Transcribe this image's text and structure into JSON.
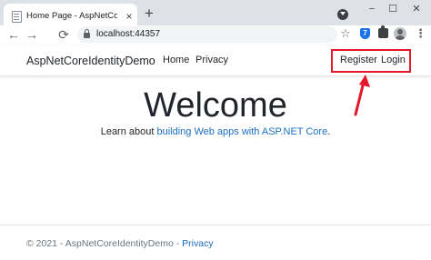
{
  "browser": {
    "tab_title": "Home Page - AspNetCoreIdentit",
    "tab_close": "×",
    "new_tab": "+",
    "url": "localhost:44357",
    "window_controls": {
      "minimize": "−",
      "maximize": "☐",
      "close": "✕"
    },
    "nav_icons": {
      "back": "←",
      "forward": "→",
      "reload": "⟳"
    },
    "star": "☆",
    "more": "⋮"
  },
  "navbar": {
    "brand": "AspNetCoreIdentityDemo",
    "links": [
      "Home",
      "Privacy"
    ],
    "auth_links": [
      "Register",
      "Login"
    ]
  },
  "annotation": {
    "color": "#e5172b"
  },
  "main": {
    "heading": "Welcome",
    "lead_prefix": "Learn about ",
    "lead_link": "building Web apps with ASP.NET Core",
    "lead_suffix": "."
  },
  "footer": {
    "text": "© 2021 - AspNetCoreIdentityDemo - ",
    "privacy_link": "Privacy"
  },
  "colors": {
    "link": "#1b6ec2",
    "text": "#212529",
    "muted": "#6c757d",
    "tabstrip": "#dee1e6"
  }
}
